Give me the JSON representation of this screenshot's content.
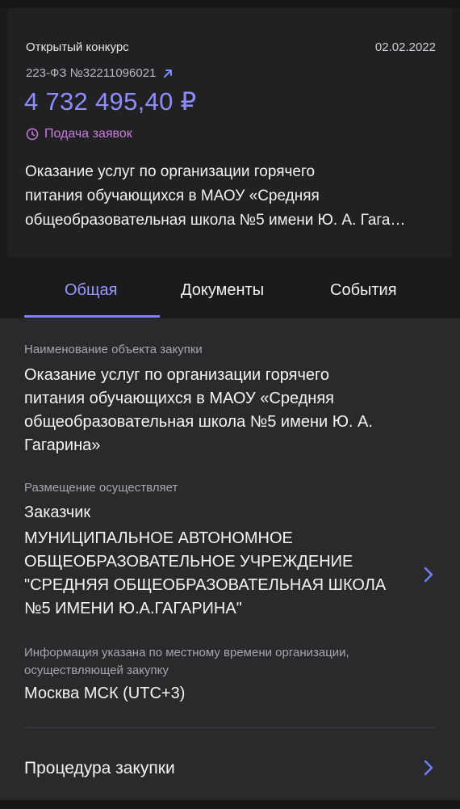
{
  "card": {
    "type": "Открытый конкурс",
    "date": "02.02.2022",
    "registry": "223-ФЗ №32211096021",
    "price": "4 732 495,40 ₽",
    "status": "Подача заявок",
    "description_line1": "Оказание услуг по организации горячего",
    "description_line2": "питания обучающихся в МАОУ «Средняя",
    "description_line3": "общеобразовательная школа №5 имени Ю. А. Гага…"
  },
  "tabs": [
    {
      "label": "Общая"
    },
    {
      "label": "Документы"
    },
    {
      "label": "События"
    }
  ],
  "details": {
    "object_label": "Наименование объекта закупки",
    "object_line1": "Оказание услуг по организации горячего",
    "object_line2": "питания обучающихся в МАОУ «Средняя",
    "object_line3": "общеобразовательная школа №5 имени Ю. А.",
    "object_line4": "Гагарина»",
    "placement_label": "Размещение осуществляет",
    "placement_role": "Заказчик",
    "placement_line1": "МУНИЦИПАЛЬНОЕ АВТОНОМНОЕ",
    "placement_line2": "ОБЩЕОБРАЗОВАТЕЛЬНОЕ УЧРЕЖДЕНИЕ",
    "placement_line3": "\"СРЕДНЯЯ ОБЩЕОБРАЗОВАТЕЛЬНАЯ ШКОЛА",
    "placement_line4": "№5 ИМЕНИ Ю.А.ГАГАРИНА\"",
    "timezone_label_line1": "Информация указана по местному времени организации,",
    "timezone_label_line2": "осуществляющей закупку",
    "timezone_value": "Москва МСК (UTC+3)",
    "procedure_label": "Процедура закупки"
  },
  "colors": {
    "accent": "#8d8dff",
    "status": "#c77ddb",
    "background": "#1b1b1d",
    "panel": "#2a2a2d"
  }
}
